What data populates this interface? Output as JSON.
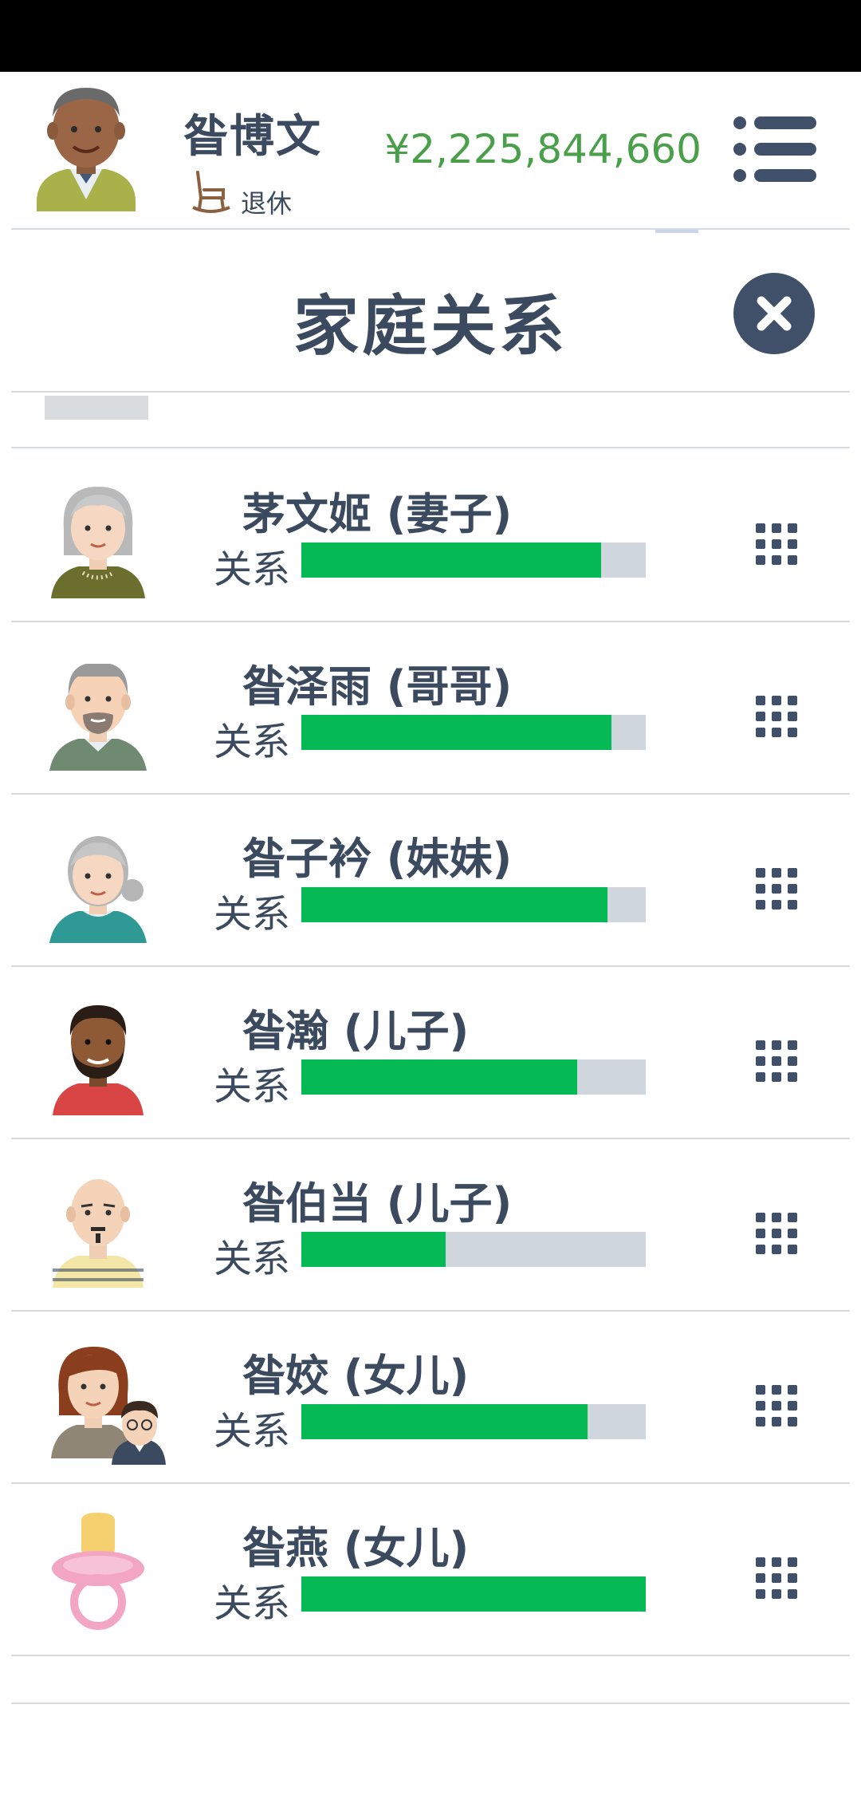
{
  "header": {
    "player_name": "昝博文",
    "status_icon": "rocking-chair-icon",
    "status_text": "退休",
    "money": "¥2,225,844,660",
    "menu_icon": "menu-list-icon"
  },
  "dialog": {
    "title": "家庭关系",
    "close_icon": "close-icon"
  },
  "relationship_label": "关系",
  "family": [
    {
      "name": "茅文姬 (妻子)",
      "relation": 0.87,
      "avatar": "elderly-woman-avatar"
    },
    {
      "name": "昝泽雨 (哥哥)",
      "relation": 0.9,
      "avatar": "elderly-man-avatar"
    },
    {
      "name": "昝子衿 (妹妹)",
      "relation": 0.89,
      "avatar": "elderly-woman-bun-avatar"
    },
    {
      "name": "昝瀚 (儿子)",
      "relation": 0.8,
      "avatar": "bearded-man-avatar"
    },
    {
      "name": "昝伯当 (儿子)",
      "relation": 0.42,
      "avatar": "bald-man-avatar"
    },
    {
      "name": "昝姣 (女儿)",
      "relation": 0.83,
      "avatar": "woman-with-partner-avatar"
    },
    {
      "name": "昝燕 (女儿)",
      "relation": 1.0,
      "avatar": "pacifier-baby-avatar"
    }
  ],
  "colors": {
    "money": "#4aa04a",
    "bar_fill": "#05b955",
    "bar_track": "#cfd6de",
    "text": "#3b4a5e",
    "close_button": "#3f5068"
  }
}
